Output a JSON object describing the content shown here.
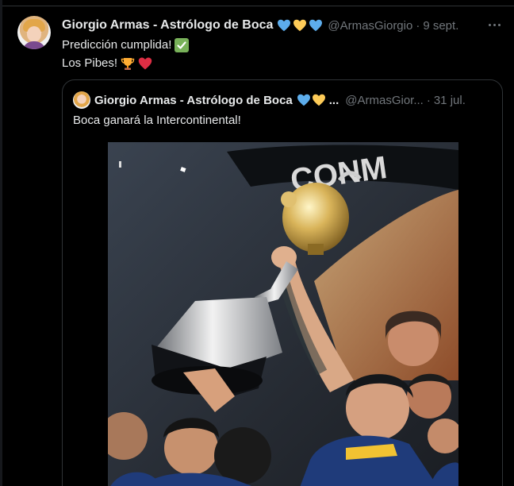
{
  "tweet": {
    "author_name": "Giorgio Armas - Astrólogo de Boca",
    "author_handle": "@ArmasGiorgio",
    "date": "9 sept.",
    "dot": "·",
    "line1": "Predicción cumplida!",
    "line2": "Los Pibes!",
    "badges": [
      "blue-heart-icon",
      "yellow-heart-icon",
      "blue-heart-icon"
    ],
    "line1_emoji": "check-mark-icon",
    "line2_emoji": [
      "trophy-icon",
      "red-heart-icon"
    ]
  },
  "quoted_tweet": {
    "author_name": "Giorgio Armas - Astrólogo de Boca",
    "ellipsis": "...",
    "author_handle": "@ArmasGior...",
    "date": "31 jul.",
    "dot": "·",
    "text": "Boca ganará la Intercontinental!",
    "badges": [
      "blue-heart-icon",
      "yellow-heart-icon"
    ],
    "photo_banner_text": "CONM"
  },
  "colors": {
    "background": "#000000",
    "text": "#e7e9ea",
    "secondary_text": "#71767b",
    "border": "#2f3336",
    "blue_heart": "#5dadec",
    "yellow_heart": "#fdcb58",
    "red_heart": "#dd2e44",
    "check_green": "#78b159"
  }
}
